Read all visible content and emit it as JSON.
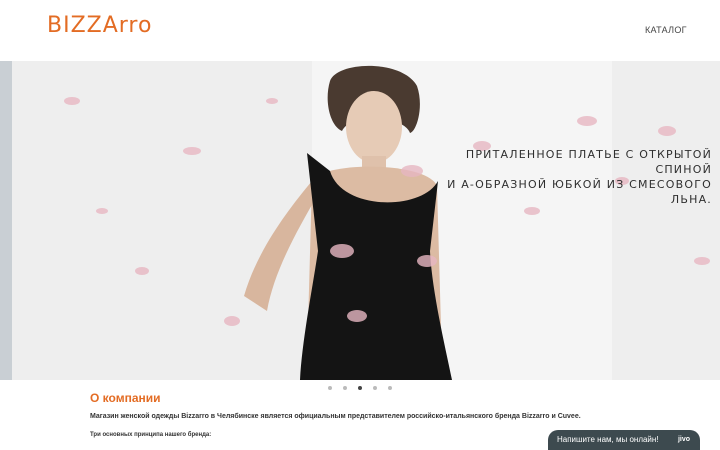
{
  "header": {
    "logo_text": "BIZZArro",
    "nav": {
      "catalog_label": "КАТАЛОГ"
    }
  },
  "hero": {
    "caption_line1": "ПРИТАЛЕННОЕ ПЛАТЬЕ С ОТКРЫТОЙ СПИНОЙ",
    "caption_line2": "И А-ОБРАЗНОЙ ЮБКОЙ ИЗ СМЕСОВОГО ЛЬНА.",
    "slider": {
      "slide_count": 5,
      "active_index": 2
    }
  },
  "about": {
    "title": "О компании",
    "text": "Магазин женской одежды Bizzarro в Челябинске является официальным представителем российско-итальянского бренда Bizzarro и Cuvee.",
    "subtitle": "Три основных принципа нашего бренда:"
  },
  "chat": {
    "label": "Напишите нам, мы онлайн!",
    "brand": "jivo"
  },
  "colors": {
    "accent": "#e36c24",
    "chat_bg": "#3d4a4f"
  }
}
